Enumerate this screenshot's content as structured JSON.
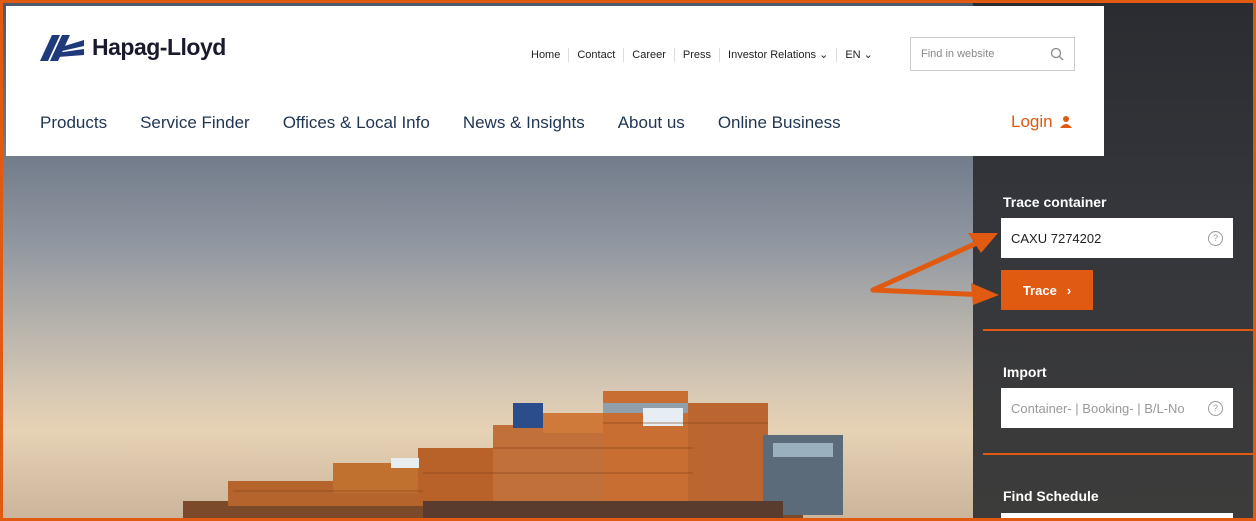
{
  "brand": {
    "name": "Hapag-Lloyd"
  },
  "topnav": [
    "Home",
    "Contact",
    "Career",
    "Press",
    "Investor Relations ⌄",
    "EN ⌄"
  ],
  "search": {
    "placeholder": "Find in website"
  },
  "mainnav": [
    "Products",
    "Service Finder",
    "Offices & Local Info",
    "News & Insights",
    "About us",
    "Online Business"
  ],
  "login": {
    "label": "Login"
  },
  "trace": {
    "title": "Trace container",
    "value": "CAXU  7274202",
    "button": "Trace",
    "button_chevron": "›"
  },
  "import": {
    "title": "Import",
    "placeholder": "Container- | Booking- | B/L-No"
  },
  "schedule": {
    "title": "Find Schedule"
  },
  "colors": {
    "accent": "#e05a12",
    "navy": "#1f3552"
  }
}
